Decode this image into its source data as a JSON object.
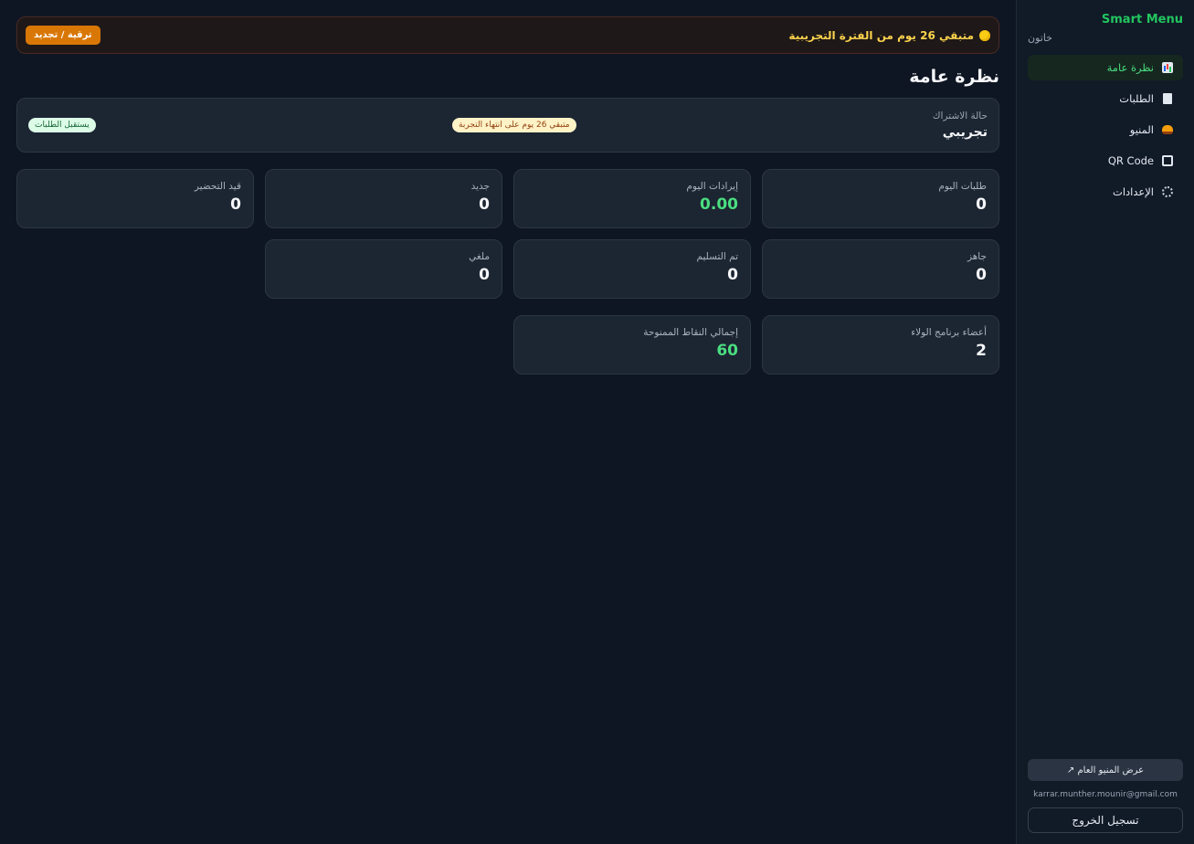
{
  "sidebar": {
    "brand": "Smart Menu",
    "subtitle": "خاتون",
    "items": [
      {
        "label": "نظرة عامة"
      },
      {
        "label": "الطلبات"
      },
      {
        "label": "المنيو"
      },
      {
        "label": "QR Code"
      },
      {
        "label": "الإعدادات"
      }
    ],
    "public_menu_label": "عرض المنيو العام ↗",
    "email": "karrar.munther.mounir@gmail.com",
    "logout_label": "تسجيل الخروج"
  },
  "trial": {
    "text": "متبقي 26 يوم من الفترة التجريبية",
    "upgrade_label": "ترقية / تجديد"
  },
  "page": {
    "title": "نظرة عامة"
  },
  "subscription": {
    "label": "حالة الاشتراك",
    "value": "تجريبي",
    "remaining_badge": "متبقي 26 يوم على انتهاء التجربة",
    "status_badge": "يستقبل الطلبات"
  },
  "stats": {
    "today_orders": {
      "label": "طلبات اليوم",
      "value": "0"
    },
    "today_revenue": {
      "label": "إيرادات اليوم",
      "value": "0.00"
    },
    "new": {
      "label": "جديد",
      "value": "0"
    },
    "preparing": {
      "label": "قيد التحضير",
      "value": "0"
    },
    "ready": {
      "label": "جاهز",
      "value": "0"
    },
    "delivered": {
      "label": "تم التسليم",
      "value": "0"
    },
    "cancelled": {
      "label": "ملغي",
      "value": "0"
    },
    "loyalty_members": {
      "label": "أعضاء برنامج الولاء",
      "value": "2"
    },
    "total_points": {
      "label": "إجمالي النقاط الممنوحة",
      "value": "60"
    }
  },
  "colors": {
    "accent": "#22c55e",
    "warning": "#d97706"
  }
}
